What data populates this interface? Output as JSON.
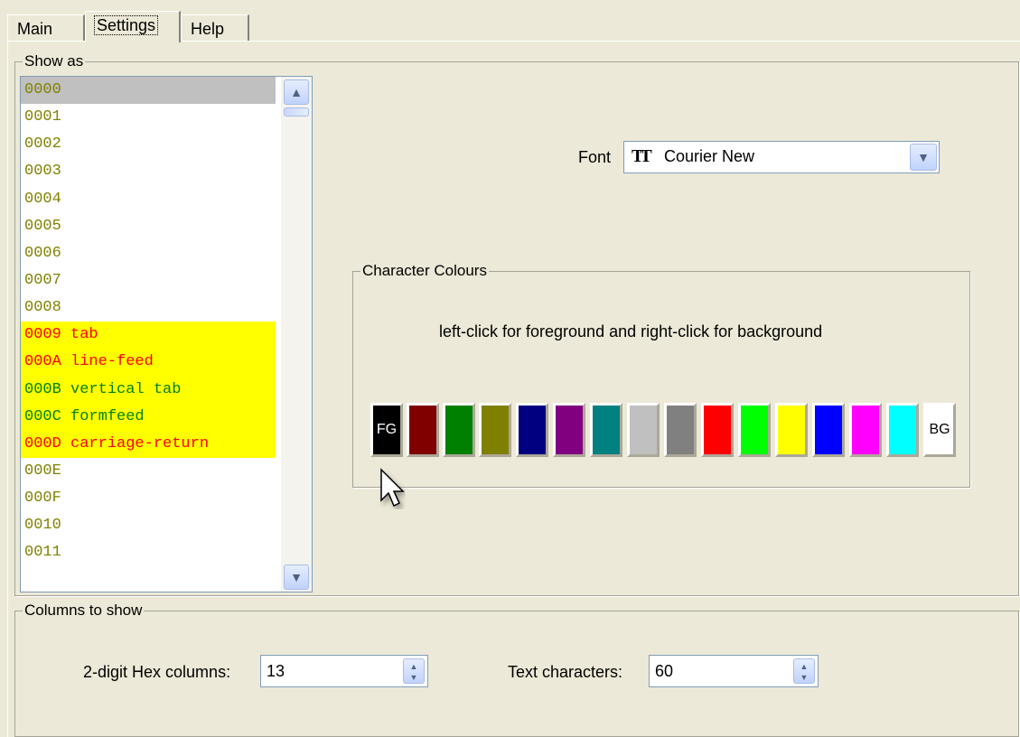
{
  "tabs": [
    "Main",
    "Settings",
    "Help"
  ],
  "active_tab": "Settings",
  "show_as": {
    "legend": "Show as",
    "items": [
      {
        "text": "0000",
        "style": "selected"
      },
      {
        "text": "0001",
        "style": "normal"
      },
      {
        "text": "0002",
        "style": "normal"
      },
      {
        "text": "0003",
        "style": "normal"
      },
      {
        "text": "0004",
        "style": "normal"
      },
      {
        "text": "0005",
        "style": "normal"
      },
      {
        "text": "0006",
        "style": "normal"
      },
      {
        "text": "0007",
        "style": "normal"
      },
      {
        "text": "0008",
        "style": "normal"
      },
      {
        "text": "0009 tab",
        "style": "hl-red"
      },
      {
        "text": "000A line-feed",
        "style": "hl-red"
      },
      {
        "text": "000B vertical tab",
        "style": "hl-green"
      },
      {
        "text": "000C formfeed",
        "style": "hl-green"
      },
      {
        "text": "000D carriage-return",
        "style": "hl-red"
      },
      {
        "text": "000E",
        "style": "normal"
      },
      {
        "text": "000F",
        "style": "normal"
      },
      {
        "text": "0010",
        "style": "normal"
      },
      {
        "text": "0011",
        "style": "normal"
      }
    ]
  },
  "font": {
    "label": "Font",
    "value": "Courier New",
    "icon": "truetype-font-icon",
    "icon_glyph": "TT"
  },
  "character_colours": {
    "legend": "Character Colours",
    "instruction": "left-click for foreground and right-click for background",
    "swatches": [
      {
        "color": "#000000",
        "label": "FG",
        "text_color": "#ffffff"
      },
      {
        "color": "#800000",
        "label": ""
      },
      {
        "color": "#008000",
        "label": ""
      },
      {
        "color": "#808000",
        "label": ""
      },
      {
        "color": "#000080",
        "label": ""
      },
      {
        "color": "#800080",
        "label": ""
      },
      {
        "color": "#008080",
        "label": ""
      },
      {
        "color": "#c0c0c0",
        "label": ""
      },
      {
        "color": "#808080",
        "label": ""
      },
      {
        "color": "#ff0000",
        "label": ""
      },
      {
        "color": "#00ff00",
        "label": ""
      },
      {
        "color": "#ffff00",
        "label": ""
      },
      {
        "color": "#0000ff",
        "label": ""
      },
      {
        "color": "#ff00ff",
        "label": ""
      },
      {
        "color": "#00ffff",
        "label": ""
      },
      {
        "color": "#ffffff",
        "label": "BG",
        "text_color": "#000000"
      }
    ]
  },
  "columns": {
    "legend": "Columns to show",
    "hex_label": "2-digit Hex columns:",
    "hex_value": "13",
    "text_label": "Text characters:",
    "text_value": "60"
  }
}
